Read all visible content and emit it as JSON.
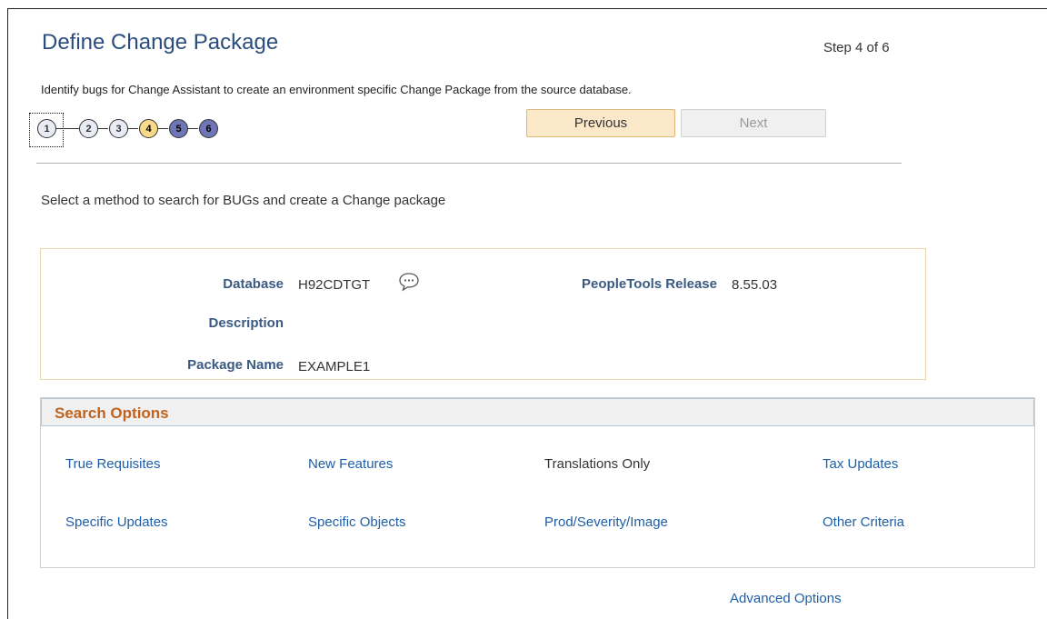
{
  "page": {
    "title": "Define Change Package",
    "step": "Step 4 of 6",
    "instructions": "Identify bugs for Change Assistant to create an environment specific Change Package from the source database."
  },
  "train": {
    "stops": [
      "1",
      "2",
      "3",
      "4",
      "5",
      "6"
    ]
  },
  "nav": {
    "previous": "Previous",
    "next": "Next"
  },
  "method_text": "Select a method to search for BUGs and create a Change package",
  "info": {
    "database_label": "Database",
    "database_value": "H92CDTGT",
    "tools_label": "PeopleTools Release",
    "tools_value": "8.55.03",
    "description_label": "Description",
    "package_label": "Package Name",
    "package_value": "EXAMPLE1"
  },
  "search": {
    "title": "Search Options",
    "row1": [
      "True Requisites",
      "New Features",
      "Translations Only",
      "Tax Updates"
    ],
    "row2": [
      "Specific Updates",
      "Specific Objects",
      "Prod/Severity/Image",
      "Other Criteria"
    ]
  },
  "advanced": "Advanced Options",
  "colors": {
    "title": "#2a4d7d",
    "link": "#1f5ea8",
    "section_title": "#c0631f",
    "current_step": "#f9d98a",
    "future_step": "#6f76b7"
  }
}
